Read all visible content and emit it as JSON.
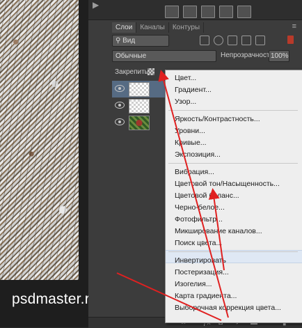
{
  "watermark": "psdmaster.ru",
  "panel": {
    "tabs": [
      "Слои",
      "Каналы",
      "Контуры"
    ],
    "filter_kind": "Вид",
    "blend_mode": "Обычные",
    "opacity_label": "Непрозрачность:",
    "opacity_value": "100%",
    "lock_label": "Закрепить:"
  },
  "menu": {
    "items": [
      "Цвет...",
      "Градиент...",
      "Узор...",
      "Яркость/Контрастность...",
      "Уровни...",
      "Кривые...",
      "Экспозиция...",
      "Вибрация...",
      "Цветовой тон/Насыщенность...",
      "Цветовой баланс...",
      "Черно-белое...",
      "Фотофильтр...",
      "Микширование каналов...",
      "Поиск цвета...",
      "Инвертировать",
      "Постеризация...",
      "Изогелия...",
      "Карта градиента...",
      "Выборочная коррекция цвета..."
    ],
    "highlighted": "Цветовой тон/Насыщенность..."
  },
  "colors": {
    "arrow": "#e02020",
    "menu_bg": "#eeeeee",
    "selected_layer": "#566b83"
  }
}
